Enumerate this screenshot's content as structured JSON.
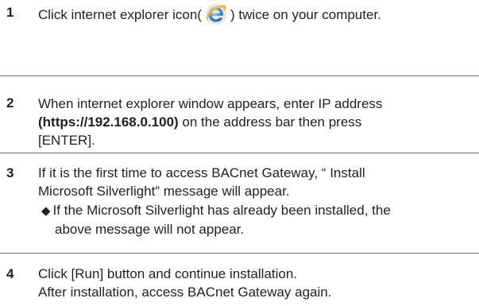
{
  "steps": [
    {
      "number": "1",
      "text_before_icon": "Click internet explorer icon(",
      "icon": "internet-explorer-icon",
      "text_after_icon": ") twice on your computer."
    },
    {
      "number": "2",
      "line1": "When internet explorer window appears, enter IP address",
      "address": "(https://192.168.0.100)",
      "line2_rest": " on the address bar then press",
      "line3": "[ENTER]."
    },
    {
      "number": "3",
      "line1": "If it is the first time to access BACnet Gateway, “ Install",
      "line2": "Microsoft Silverlight” message will appear.",
      "note_bullet": "◆",
      "note_line1": "If the Microsoft Silverlight has already been installed, the",
      "note_line2": "above message will not appear."
    },
    {
      "number": "4",
      "line1": "Click [Run] button and continue installation.",
      "line2": "After installation, access BACnet Gateway again."
    }
  ],
  "colors": {
    "text": "#231f20",
    "divider": "#6d6e71",
    "ie_blue": "#3a8fd6",
    "ie_ring": "#f2b630"
  }
}
